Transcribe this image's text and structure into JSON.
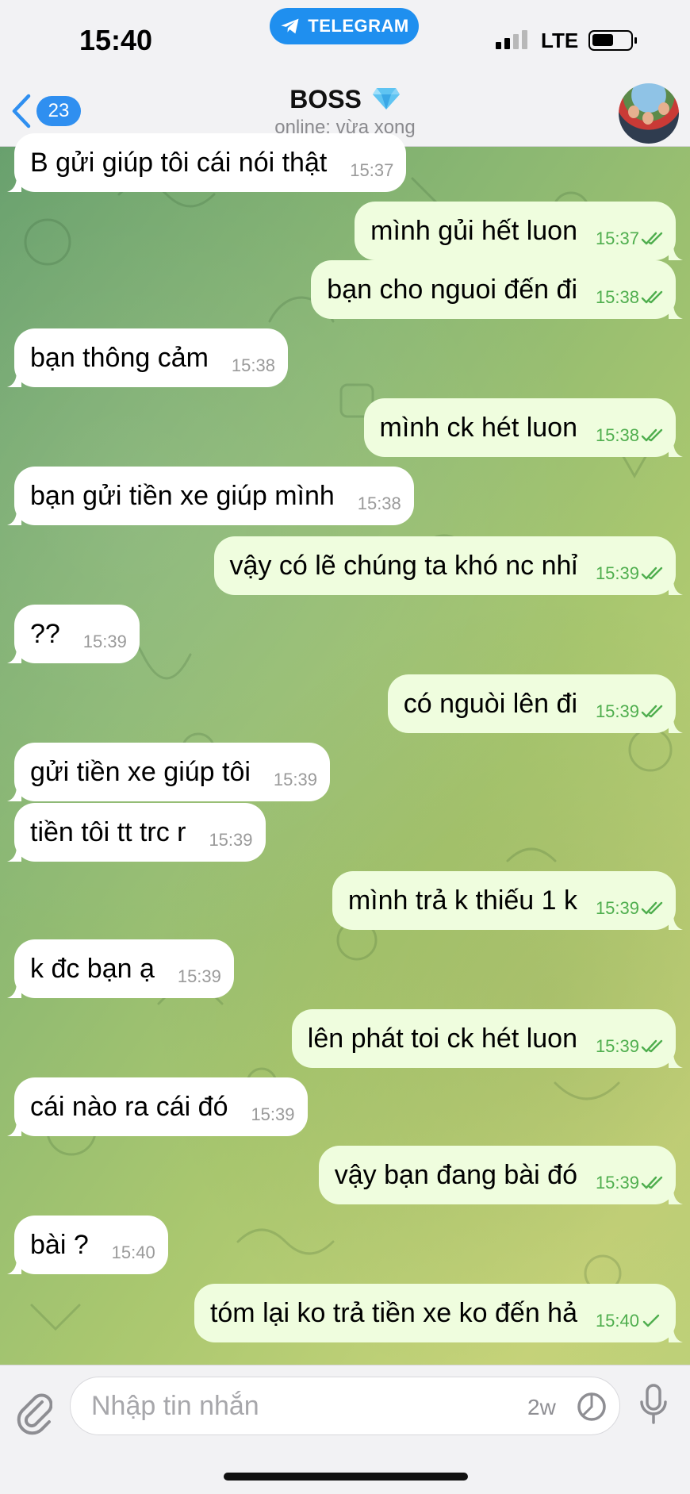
{
  "status_bar": {
    "time": "15:40",
    "app_pill": "TELEGRAM",
    "network": "LTE"
  },
  "header": {
    "back_count": "23",
    "title": "BOSS",
    "title_emoji_icon": "gem-icon",
    "status": "online: vừa xong"
  },
  "messages": [
    {
      "dir": "in",
      "text": "B gửi giúp tôi cái nói thật",
      "time": "15:37"
    },
    {
      "dir": "out",
      "text": "mình gủi hết luon",
      "time": "15:37"
    },
    {
      "dir": "out",
      "text": "bạn cho nguoi đến đi",
      "time": "15:38"
    },
    {
      "dir": "in",
      "text": "bạn thông cảm",
      "time": "15:38"
    },
    {
      "dir": "out",
      "text": "mình ck hét luon",
      "time": "15:38"
    },
    {
      "dir": "in",
      "text": "bạn gửi tiền xe giúp mình",
      "time": "15:38"
    },
    {
      "dir": "out",
      "text": "vậy có lẽ chúng ta khó nc nhỉ",
      "time": "15:39"
    },
    {
      "dir": "in",
      "text": "??",
      "time": "15:39"
    },
    {
      "dir": "out",
      "text": "có nguòi lên đi",
      "time": "15:39"
    },
    {
      "dir": "in",
      "text": "gửi tiền xe giúp tôi",
      "time": "15:39"
    },
    {
      "dir": "in",
      "text": "tiền tôi tt trc r",
      "time": "15:39"
    },
    {
      "dir": "out",
      "text": "mình trả k thiếu 1 k",
      "time": "15:39"
    },
    {
      "dir": "in",
      "text": "k đc bạn ạ",
      "time": "15:39"
    },
    {
      "dir": "out",
      "text": "lên phát toi ck hét luon",
      "time": "15:39"
    },
    {
      "dir": "in",
      "text": "cái nào ra cái đó",
      "time": "15:39"
    },
    {
      "dir": "out",
      "text": "vậy  bạn đang bài đó",
      "time": "15:39"
    },
    {
      "dir": "in",
      "text": "bài ?",
      "time": "15:40"
    },
    {
      "dir": "out",
      "text": "tóm lại ko trả tiền xe ko đến hả",
      "time": "15:40"
    }
  ],
  "input": {
    "placeholder": "Nhập tin nhắn",
    "timer_label": "2w"
  },
  "colors": {
    "accent": "#2f8ff0",
    "outgoing_bubble": "#effdde",
    "incoming_bubble": "#ffffff",
    "read_ticks": "#4fae4e"
  }
}
